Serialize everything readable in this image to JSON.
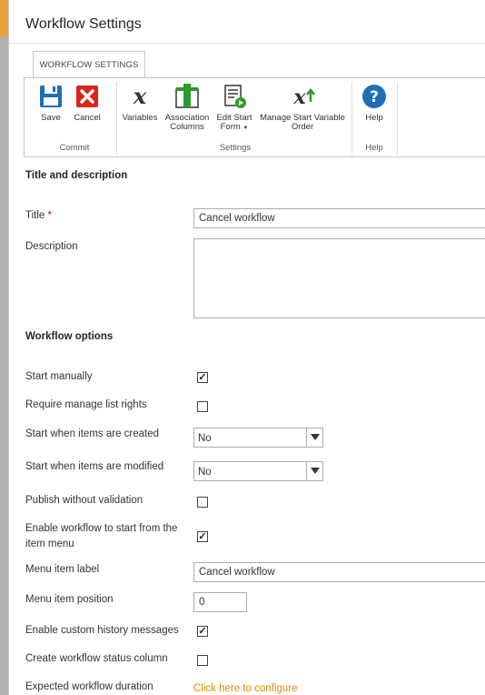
{
  "window": {
    "title": "Workflow Settings"
  },
  "ribbon": {
    "tab_label": "WORKFLOW SETTINGS",
    "buttons": {
      "save": "Save",
      "cancel": "Cancel",
      "variables": "Variables",
      "association_columns_1": "Association",
      "association_columns_2": "Columns",
      "edit_start_form_1": "Edit Start",
      "edit_start_form_2": "Form",
      "manage_start_variable_order_1": "Manage Start Variable",
      "manage_start_variable_order_2": "Order",
      "help": "Help"
    },
    "groups": {
      "commit": "Commit",
      "settings": "Settings",
      "help": "Help"
    },
    "colors": {
      "save_blue": "#1e6fb8",
      "cancel_red": "#d9261c",
      "help_blue": "#1e6fb8",
      "green": "#2e9a2e",
      "accent": "#e9a23b"
    }
  },
  "sections": {
    "title_desc": "Title and description",
    "options": "Workflow options"
  },
  "fields": {
    "title_label": "Title",
    "title_required_mark": "*",
    "title_value": "Cancel workflow",
    "description_label": "Description",
    "description_value": "",
    "start_manually_label": "Start manually",
    "start_manually": true,
    "require_manage_label": "Require manage list rights",
    "require_manage": false,
    "start_created_label": "Start when items are created",
    "start_created_value": "No",
    "start_modified_label": "Start when items are modified",
    "start_modified_value": "No",
    "publish_wo_validation_label": "Publish without validation",
    "publish_wo_validation": false,
    "enable_item_menu_label_1": "Enable workflow to start from the",
    "enable_item_menu_label_2": "item menu",
    "enable_item_menu": true,
    "menu_item_label_label": "Menu item label",
    "menu_item_label_value": "Cancel workflow",
    "menu_item_position_label": "Menu item position",
    "menu_item_position_value": "0",
    "custom_history_label": "Enable custom history messages",
    "custom_history": true,
    "status_column_label": "Create workflow status column",
    "status_column": false,
    "expected_duration_label": "Expected workflow duration",
    "expected_duration_link": "Click here to configure"
  }
}
